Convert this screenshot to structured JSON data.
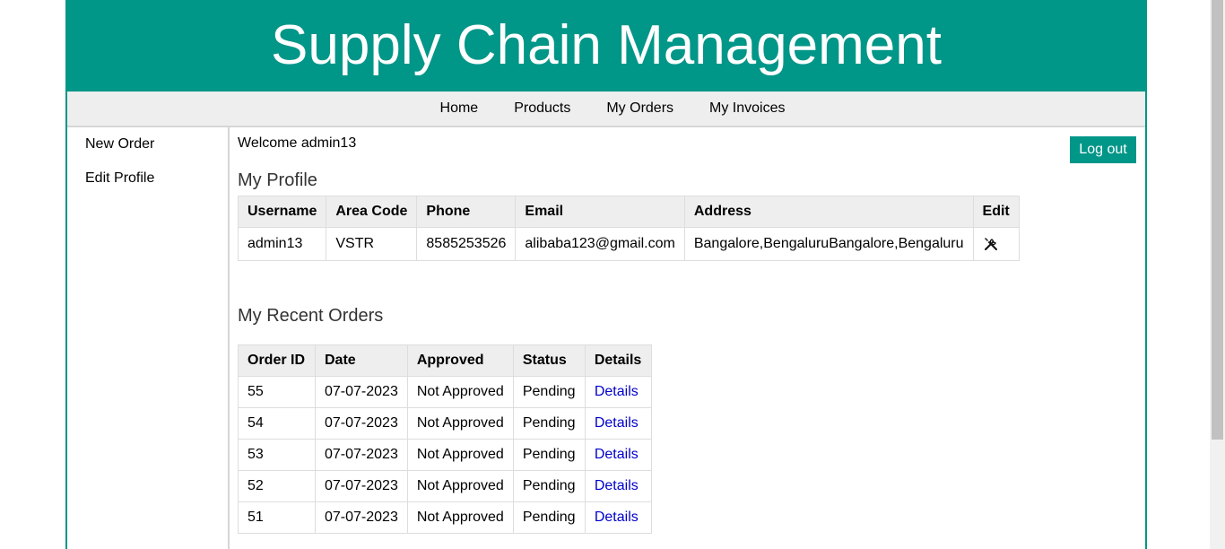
{
  "header": {
    "title": "Supply Chain Management"
  },
  "nav": {
    "items": [
      {
        "label": "Home"
      },
      {
        "label": "Products"
      },
      {
        "label": "My Orders"
      },
      {
        "label": "My Invoices"
      }
    ]
  },
  "sidebar": {
    "items": [
      {
        "label": "New Order"
      },
      {
        "label": "Edit Profile"
      }
    ]
  },
  "welcome": "Welcome admin13",
  "logout_label": "Log out",
  "profile": {
    "heading": "My Profile",
    "columns": [
      "Username",
      "Area Code",
      "Phone",
      "Email",
      "Address",
      "Edit"
    ],
    "row": {
      "username": "admin13",
      "area_code": "VSTR",
      "phone": "8585253526",
      "email": "alibaba123@gmail.com",
      "address": "Bangalore,BengaluruBangalore,Bengaluru",
      "edit_icon": "tools-icon"
    }
  },
  "orders": {
    "heading": "My Recent Orders",
    "columns": [
      "Order ID",
      "Date",
      "Approved",
      "Status",
      "Details"
    ],
    "rows": [
      {
        "id": "55",
        "date": "07-07-2023",
        "approved": "Not Approved",
        "status": "Pending",
        "details": "Details"
      },
      {
        "id": "54",
        "date": "07-07-2023",
        "approved": "Not Approved",
        "status": "Pending",
        "details": "Details"
      },
      {
        "id": "53",
        "date": "07-07-2023",
        "approved": "Not Approved",
        "status": "Pending",
        "details": "Details"
      },
      {
        "id": "52",
        "date": "07-07-2023",
        "approved": "Not Approved",
        "status": "Pending",
        "details": "Details"
      },
      {
        "id": "51",
        "date": "07-07-2023",
        "approved": "Not Approved",
        "status": "Pending",
        "details": "Details"
      }
    ]
  },
  "colors": {
    "accent": "#009688",
    "link": "#0000cc"
  }
}
